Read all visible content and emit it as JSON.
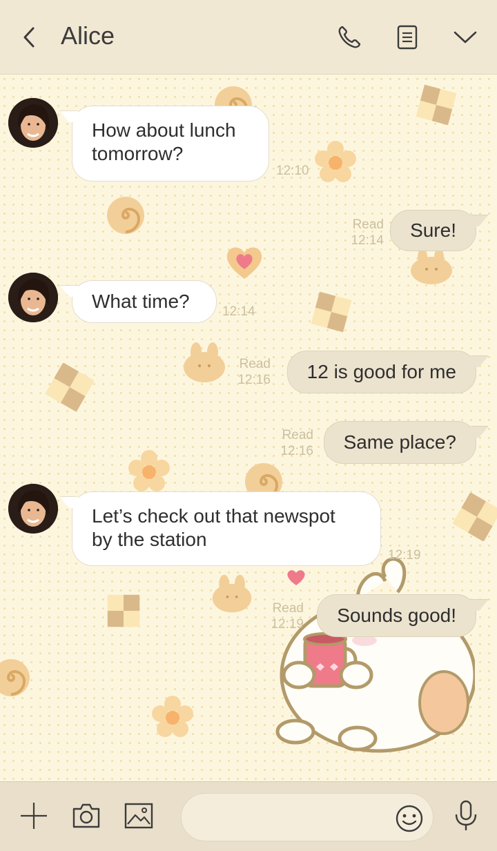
{
  "header": {
    "title": "Alice",
    "icons": [
      "back-arrow-icon",
      "phone-icon",
      "notes-icon",
      "chevron-down-icon"
    ]
  },
  "messages": [
    {
      "side": "incoming",
      "text_lines": [
        "How about lunch",
        "tomorrow?"
      ],
      "time": "12:10"
    },
    {
      "side": "outgoing",
      "text": "Sure!",
      "status": "Read",
      "time": "12:14"
    },
    {
      "side": "incoming",
      "text_lines": [
        "What time?"
      ],
      "time": "12:14"
    },
    {
      "side": "outgoing",
      "text": "12 is good for me",
      "status": "Read",
      "time": "12:16"
    },
    {
      "side": "outgoing",
      "text": "Same place?",
      "status": "Read",
      "time": "12:16"
    },
    {
      "side": "incoming",
      "text_lines": [
        "Let’s check out that newspot",
        "by the station"
      ],
      "time": "12:19"
    },
    {
      "side": "outgoing",
      "text": "Sounds good!",
      "status": "Read",
      "time": "12:19"
    }
  ],
  "composer": {
    "placeholder": "",
    "icons": [
      "plus-icon",
      "camera-icon",
      "image-icon",
      "emoji-icon",
      "microphone-icon"
    ]
  },
  "colors": {
    "header_bg": "#f1e8d4",
    "chat_bg": "#fdf6df",
    "incoming_bubble": "#ffffff",
    "outgoing_bubble": "#ece3cf",
    "meta_text": "#cbbf9f",
    "heart": "#ef7a8a"
  }
}
